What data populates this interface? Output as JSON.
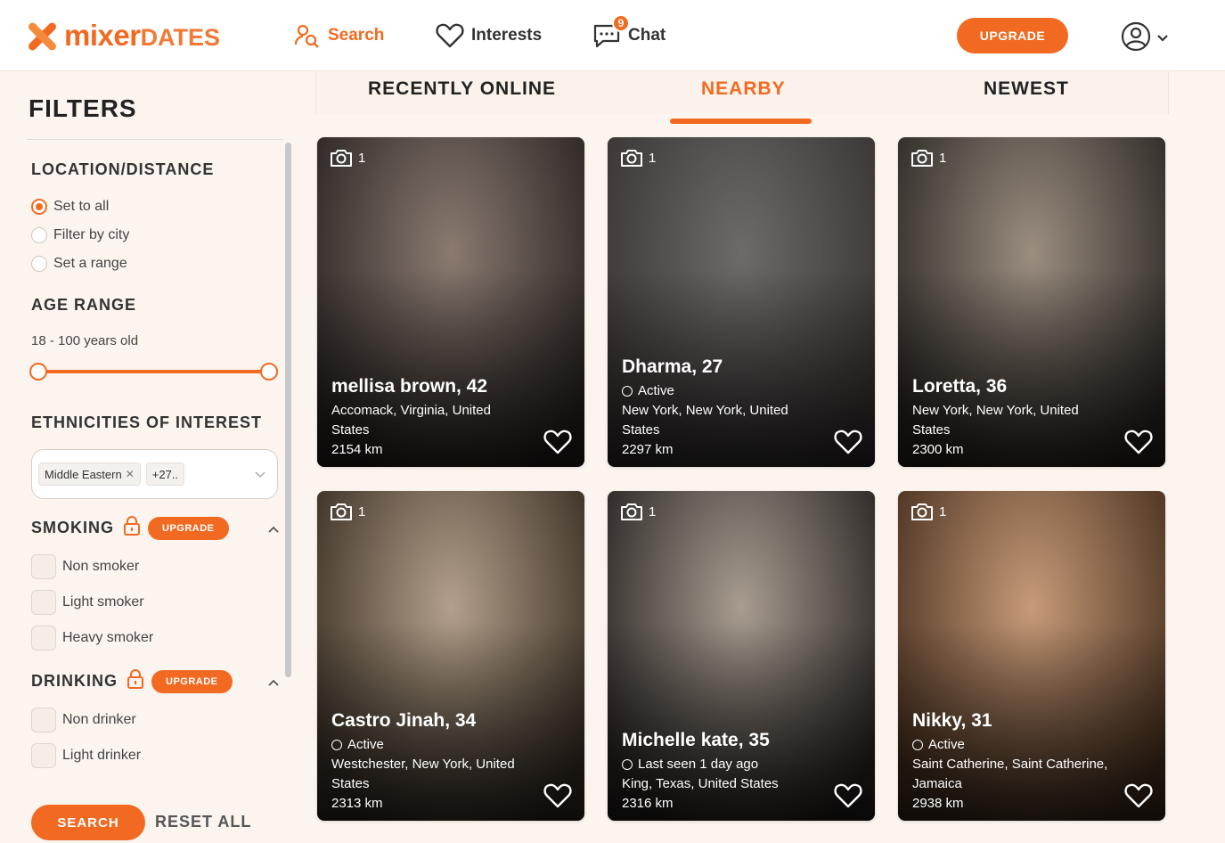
{
  "header": {
    "logo_main": "mixer",
    "logo_sub": "DATES",
    "nav": {
      "search": "Search",
      "interests": "Interests",
      "chat": "Chat",
      "chat_badge": "9"
    },
    "upgrade": "UPGRADE",
    "brand_color": "#f26a21"
  },
  "sidebar": {
    "title": "FILTERS",
    "location": {
      "title": "LOCATION/DISTANCE",
      "options": [
        "Set to all",
        "Filter by city",
        "Set a range"
      ],
      "selected": "Set to all"
    },
    "age": {
      "title": "AGE RANGE",
      "text": "18 - 100 years old",
      "min": 18,
      "max": 100
    },
    "ethnicities": {
      "title": "ETHNICITIES OF INTEREST",
      "tag": "Middle Eastern",
      "more": "+27.."
    },
    "smoking": {
      "title": "SMOKING",
      "badge": "UPGRADE",
      "options": [
        "Non smoker",
        "Light smoker",
        "Heavy smoker"
      ]
    },
    "drinking": {
      "title": "DRINKING",
      "badge": "UPGRADE",
      "options": [
        "Non drinker",
        "Light drinker"
      ]
    },
    "search_button": "SEARCH",
    "reset_button": "RESET ALL"
  },
  "tabs": {
    "items": [
      "RECENTLY ONLINE",
      "NEARBY",
      "NEWEST"
    ],
    "active": "NEARBY"
  },
  "profiles": [
    {
      "photos": "1",
      "name": "mellisa brown, 42",
      "status": "",
      "location": "Accomack, Virginia, United States",
      "distance": "2154 km",
      "photo_colors": [
        "#8a7a70",
        "#2b2523"
      ]
    },
    {
      "photos": "1",
      "name": "Dharma, 27",
      "status": "Active",
      "location": "New York, New York, United States",
      "distance": "2297 km",
      "photo_colors": [
        "#6d6a6a",
        "#3a3434"
      ]
    },
    {
      "photos": "1",
      "name": "Loretta, 36",
      "status": "",
      "location": "New York, New York, United States",
      "distance": "2300 km",
      "photo_colors": [
        "#9b8d80",
        "#2e2a26"
      ]
    },
    {
      "photos": "1",
      "name": "Castro Jinah, 34",
      "status": "Active",
      "location": "Westchester, New York, United States",
      "distance": "2313 km",
      "photo_colors": [
        "#b3a08a",
        "#3b3026"
      ]
    },
    {
      "photos": "1",
      "name": "Michelle kate, 35",
      "status": "Last seen 1 day ago",
      "location": "King, Texas, United States",
      "distance": "2316 km",
      "photo_colors": [
        "#a89c90",
        "#2a2624"
      ]
    },
    {
      "photos": "1",
      "name": "Nikky, 31",
      "status": "Active",
      "location": "Saint Catherine, Saint Catherine, Jamaica",
      "distance": "2938 km",
      "photo_colors": [
        "#c79a78",
        "#4a3220"
      ]
    }
  ]
}
